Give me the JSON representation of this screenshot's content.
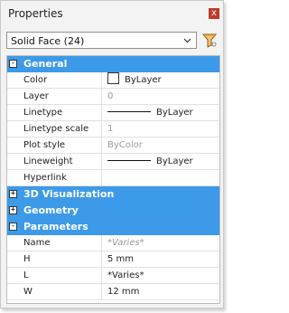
{
  "panel": {
    "title": "Properties",
    "close_glyph": "x"
  },
  "selector": {
    "value": "Solid Face (24)",
    "icon": "chevron-down-icon",
    "filter_icon": "quick-select-filter-icon"
  },
  "categories": {
    "general": {
      "label": "General",
      "toggle": "-"
    },
    "visualization": {
      "label": "3D Visualization",
      "toggle": "+"
    },
    "geometry": {
      "label": "Geometry",
      "toggle": "+"
    },
    "parameters": {
      "label": "Parameters",
      "toggle": "-"
    }
  },
  "general_rows": {
    "color": {
      "name": "Color",
      "value": "ByLayer"
    },
    "layer": {
      "name": "Layer",
      "value": "0"
    },
    "linetype": {
      "name": "Linetype",
      "value": "ByLayer"
    },
    "linetype_scale": {
      "name": "Linetype scale",
      "value": "1"
    },
    "plot_style": {
      "name": "Plot style",
      "value": "ByColor"
    },
    "lineweight": {
      "name": "Lineweight",
      "value": "ByLayer"
    },
    "hyperlink": {
      "name": "Hyperlink",
      "value": ""
    }
  },
  "parameter_rows": {
    "name": {
      "name": "Name",
      "value": "*Varies*"
    },
    "h": {
      "name": "H",
      "value": "5 mm"
    },
    "l": {
      "name": "L",
      "value": "*Varies*"
    },
    "w": {
      "name": "W",
      "value": "12 mm"
    }
  },
  "colors": {
    "category_bg": "#3d9ae8",
    "close_bg": "#c0392b",
    "filter_orange": "#e8a23a"
  }
}
